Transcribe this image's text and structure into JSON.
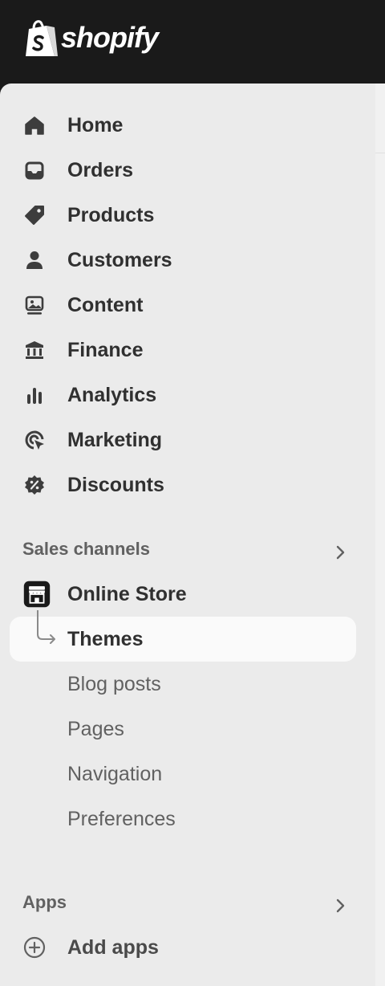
{
  "brand": {
    "name": "shopify"
  },
  "nav": {
    "items": [
      {
        "label": "Home",
        "icon": "home-icon"
      },
      {
        "label": "Orders",
        "icon": "inbox-icon"
      },
      {
        "label": "Products",
        "icon": "tag-icon"
      },
      {
        "label": "Customers",
        "icon": "person-icon"
      },
      {
        "label": "Content",
        "icon": "image-icon"
      },
      {
        "label": "Finance",
        "icon": "bank-icon"
      },
      {
        "label": "Analytics",
        "icon": "bar-chart-icon"
      },
      {
        "label": "Marketing",
        "icon": "target-icon"
      },
      {
        "label": "Discounts",
        "icon": "discount-icon"
      }
    ]
  },
  "sales_channels": {
    "label": "Sales channels",
    "online_store": {
      "label": "Online Store",
      "icon": "storefront-icon"
    },
    "subitems": [
      {
        "label": "Themes",
        "active": true
      },
      {
        "label": "Blog posts"
      },
      {
        "label": "Pages"
      },
      {
        "label": "Navigation"
      },
      {
        "label": "Preferences"
      }
    ]
  },
  "apps": {
    "label": "Apps",
    "add": {
      "label": "Add apps",
      "icon": "plus-circle-icon"
    }
  },
  "colors": {
    "topbar": "#1a1a1a",
    "sidebar": "#ebebeb",
    "text_primary": "#303030",
    "text_secondary": "#616161",
    "active_bg": "#fafafa"
  }
}
